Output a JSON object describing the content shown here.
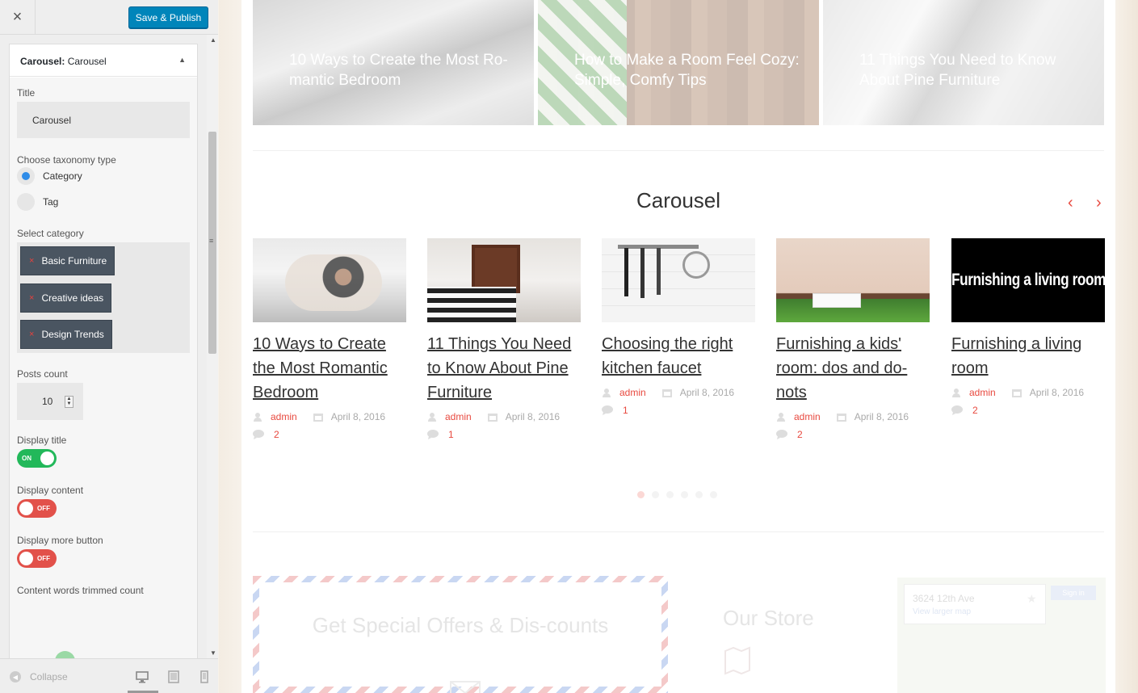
{
  "header": {
    "close_glyph": "×",
    "publish_label": "Save & Publish"
  },
  "panel": {
    "title_bold": "Carousel:",
    "title_rest": " Carousel",
    "title_label": "Title",
    "title_value": "Carousel",
    "taxonomy_label": "Choose taxonomy type",
    "taxonomy_options": [
      {
        "label": "Category",
        "checked": true
      },
      {
        "label": "Tag",
        "checked": false
      }
    ],
    "category_label": "Select category",
    "categories": [
      "Basic Furniture",
      "Creative ideas",
      "Design Trends"
    ],
    "chip_remove": "×",
    "posts_count_label": "Posts count",
    "posts_count_value": "10",
    "display_title_label": "Display title",
    "display_title_state": "ON",
    "display_content_label": "Display content",
    "display_content_state": "OFF",
    "display_more_label": "Display more button",
    "display_more_state": "OFF",
    "trim_label": "Content words trimmed count",
    "trim_slider_fraction": 0.3
  },
  "footer": {
    "collapse_label": "Collapse"
  },
  "preview": {
    "hero_posts": [
      {
        "title": "10 Ways to Create the Most Ro-mantic Bedroom"
      },
      {
        "title": "How to Make a Room Feel Cozy: Simple, Comfy Tips"
      },
      {
        "title": "11 Things You Need to Know About Pine Furniture"
      }
    ],
    "section_title": "Carousel",
    "prev_arrow": "‹",
    "next_arrow": "›",
    "thumb_text": "Furnishing a living room",
    "cards": [
      {
        "title": "10 Ways to Create the Most Romantic Bedroom",
        "author": "admin",
        "date": "April 8, 2016",
        "comments": "2"
      },
      {
        "title": "11 Things You Need to Know About Pine Furniture",
        "author": "admin",
        "date": "April 8, 2016",
        "comments": "1"
      },
      {
        "title": "Choosing the right kitchen faucet",
        "author": "admin",
        "date": "April 8, 2016",
        "comments": "1"
      },
      {
        "title": "Furnishing a kids' room: dos and do-nots",
        "author": "admin",
        "date": "April 8, 2016",
        "comments": "2"
      },
      {
        "title": "Furnishing a living room",
        "author": "admin",
        "date": "April 8, 2016",
        "comments": "2"
      }
    ],
    "pagination_count": 6,
    "pagination_active": 1,
    "offers_title": "Get Special Offers & Dis-counts",
    "store_title": "Our Store",
    "map_address": "3624 12th Ave",
    "map_link": "View larger map",
    "map_signin": "Sign in"
  },
  "colors": {
    "accent": "#e8493f",
    "publish": "#0085ba",
    "toggle_on": "#22b85a",
    "toggle_off": "#e2514a",
    "chip": "#4a5561"
  },
  "icons": [
    "close-icon",
    "caret-up-icon",
    "spinner-icon",
    "collapse-icon",
    "desktop-icon",
    "tablet-icon",
    "mobile-icon",
    "user-icon",
    "calendar-icon",
    "comment-icon",
    "chevron-left-icon",
    "chevron-right-icon",
    "map-icon",
    "mail-icon",
    "star-icon"
  ]
}
